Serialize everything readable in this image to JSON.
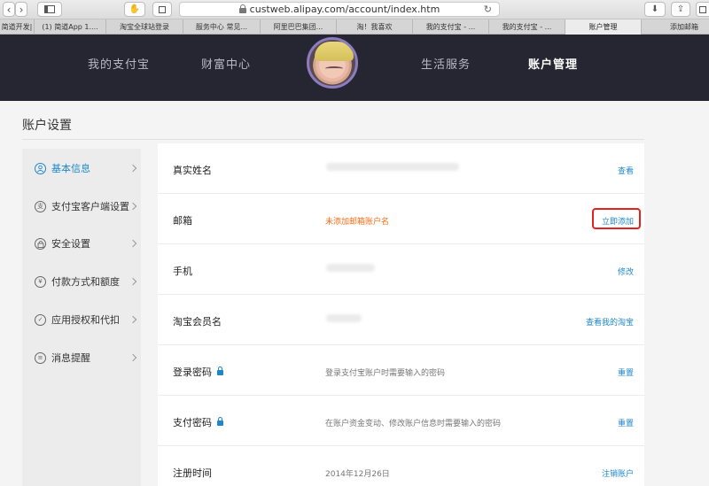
{
  "browser": {
    "url": "custweb.alipay.com/account/index.htm",
    "tabs": [
      {
        "label": "简道开发|"
      },
      {
        "label": "(1) 简道App 1...."
      },
      {
        "label": "淘宝全球站登录"
      },
      {
        "label": "服务中心 常见..."
      },
      {
        "label": "阿里巴巴集团..."
      },
      {
        "label": "淘！我喜欢"
      },
      {
        "label": "我的支付宝 - ..."
      },
      {
        "label": "我的支付宝 - ..."
      },
      {
        "label": "账户管理"
      },
      {
        "label": "添加邮箱"
      }
    ]
  },
  "header": {
    "nav": [
      {
        "label": "我的支付宝"
      },
      {
        "label": "财富中心"
      },
      {
        "label": "生活服务"
      },
      {
        "label": "账户管理"
      }
    ]
  },
  "page": {
    "title": "账户设置"
  },
  "sidebar": {
    "items": [
      {
        "label": "基本信息",
        "icon": "user-icon",
        "glyph": ""
      },
      {
        "label": "支付宝客户端设置",
        "icon": "client-icon",
        "glyph": "支"
      },
      {
        "label": "安全设置",
        "icon": "lock-icon",
        "glyph": ""
      },
      {
        "label": "付款方式和额度",
        "icon": "yuan-icon",
        "glyph": "¥"
      },
      {
        "label": "应用授权和代扣",
        "icon": "check-icon",
        "glyph": "✓"
      },
      {
        "label": "消息提醒",
        "icon": "message-icon",
        "glyph": "≡"
      }
    ]
  },
  "rows": [
    {
      "label": "真实姓名",
      "value": "",
      "action": "查看"
    },
    {
      "label": "邮箱",
      "value": "未添加邮箱账户名",
      "action": "立即添加"
    },
    {
      "label": "手机",
      "value": "",
      "action": "修改"
    },
    {
      "label": "淘宝会员名",
      "value": "",
      "action": "查看我的淘宝"
    },
    {
      "label": "登录密码",
      "value": "登录支付宝账户时需要输入的密码",
      "action": "重置"
    },
    {
      "label": "支付密码",
      "value": "在账户资金变动、修改账户信息时需要输入的密码",
      "action": "重置"
    },
    {
      "label": "注册时间",
      "value": "2014年12月26日",
      "action": "注销账户"
    }
  ],
  "colors": {
    "accent": "#1e87cc",
    "warning": "#f66d17",
    "highlight": "#e5211d",
    "header_bg": "#262633"
  }
}
